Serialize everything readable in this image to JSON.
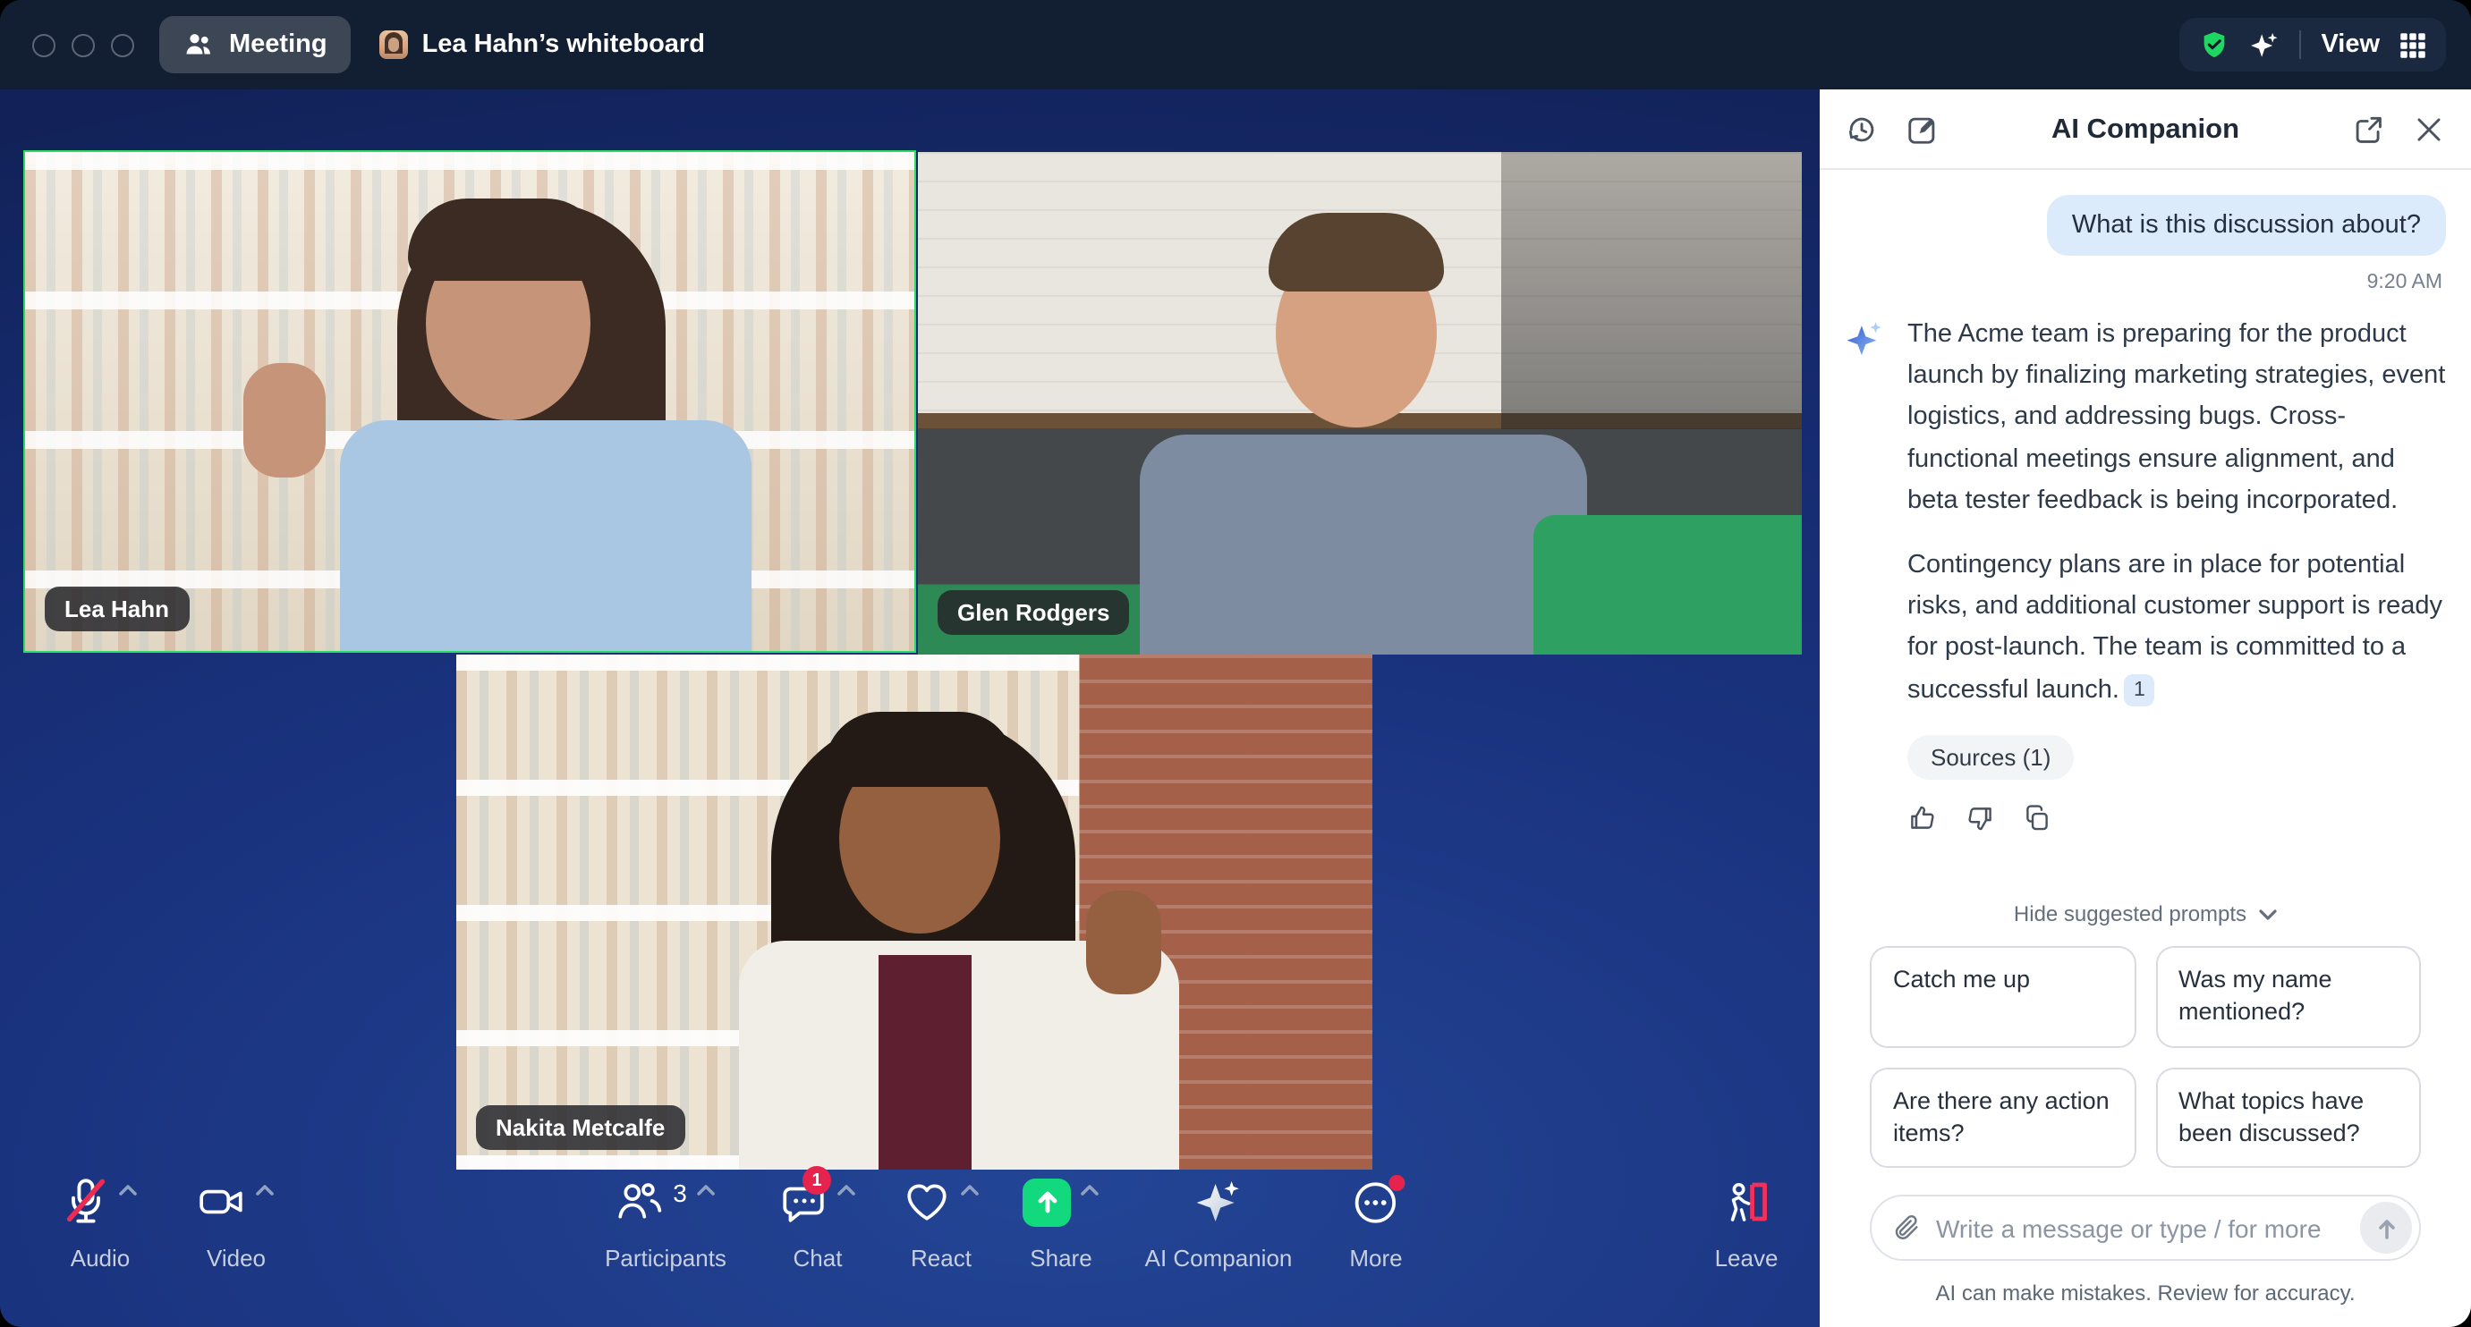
{
  "titlebar": {
    "meeting_label": "Meeting",
    "whiteboard_label": "Lea Hahn’s whiteboard",
    "view_label": "View"
  },
  "videos": {
    "tiles": [
      {
        "name": "Lea Hahn",
        "active": true
      },
      {
        "name": "Glen Rodgers",
        "active": false
      },
      {
        "name": "Nakita Metcalfe",
        "active": false
      }
    ]
  },
  "toolbar": {
    "audio": {
      "label": "Audio",
      "muted": true
    },
    "video": {
      "label": "Video"
    },
    "participants": {
      "label": "Participants",
      "count": "3"
    },
    "chat": {
      "label": "Chat",
      "badge": "1"
    },
    "react": {
      "label": "React"
    },
    "share": {
      "label": "Share"
    },
    "ai_companion": {
      "label": "AI Companion"
    },
    "more": {
      "label": "More"
    },
    "leave": {
      "label": "Leave"
    }
  },
  "panel": {
    "title": "AI Companion",
    "user_message": "What is this discussion about?",
    "timestamp": "9:20 AM",
    "ai_response": {
      "paragraph1": "The Acme team is preparing for the product launch by finalizing marketing strategies, event logistics, and addressing bugs. Cross-functional meetings ensure alignment, and beta tester feedback is being incorporated.",
      "paragraph2": "Contingency plans are in place for potential risks, and additional customer support is ready for post-launch. The team is committed to a successful launch.",
      "citation": "1"
    },
    "sources_label": "Sources (1)",
    "hide_prompts_label": "Hide suggested prompts",
    "prompts": [
      "Catch me up",
      "Was my name mentioned?",
      "Are there any action items?",
      "What topics have been discussed?"
    ],
    "composer": {
      "placeholder": "Write a message or type / for more"
    },
    "disclaimer": "AI can make mistakes. Review for accuracy."
  },
  "colors": {
    "titlebar_bg": "#121e31",
    "meeting_blue": "#1a337f",
    "shield_green": "#1ed760",
    "share_green": "#13d97e",
    "badge_red": "#e5234d",
    "leave_red": "#f2305a",
    "user_bubble_blue": "#dcebfb",
    "ai_star_blue": "#4a7de0"
  }
}
